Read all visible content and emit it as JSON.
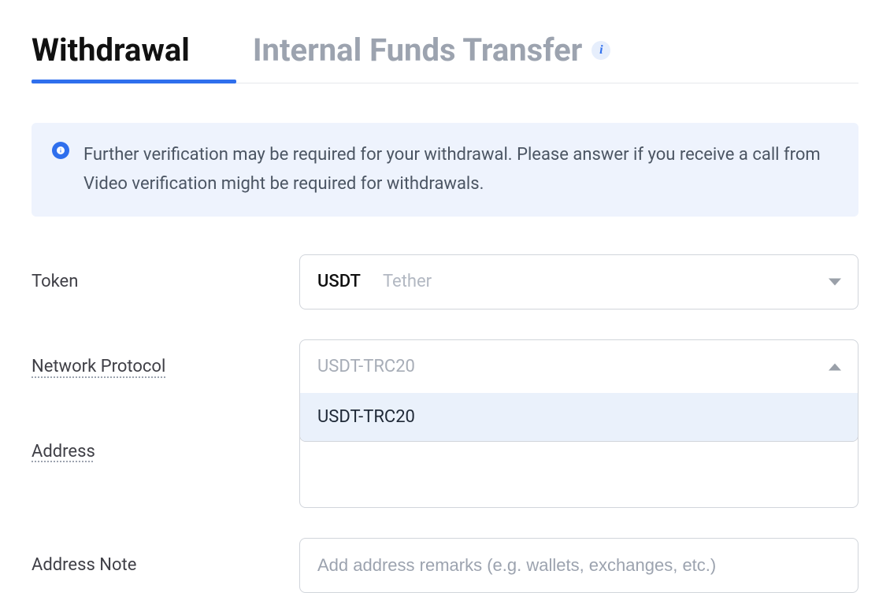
{
  "tabs": {
    "withdrawal": "Withdrawal",
    "internalTransfer": "Internal Funds Transfer"
  },
  "notice": {
    "text": "Further verification may be required for your withdrawal. Please answer if you receive a call from Video verification might be required for withdrawals."
  },
  "form": {
    "token": {
      "label": "Token",
      "symbol": "USDT",
      "name": "Tether"
    },
    "network": {
      "label": "Network Protocol",
      "selected": "USDT-TRC20",
      "options": [
        "USDT-TRC20"
      ]
    },
    "address": {
      "label": "Address",
      "value": ""
    },
    "addressNote": {
      "label": "Address Note",
      "placeholder": "Add address remarks (e.g. wallets, exchanges, etc.)",
      "value": ""
    }
  }
}
